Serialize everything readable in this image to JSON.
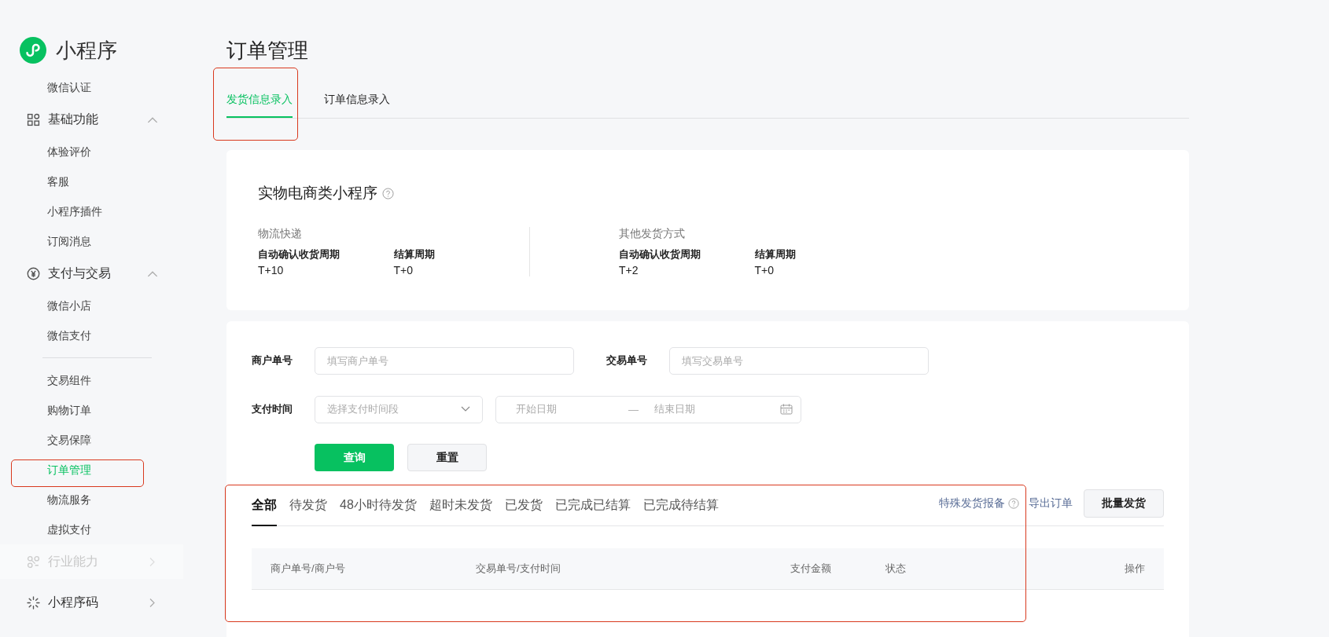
{
  "sidebar": {
    "logo": "小程序",
    "items": [
      {
        "kind": "link",
        "label": "微信认证",
        "selected": false
      },
      {
        "kind": "group",
        "label": "基础功能",
        "expanded": true,
        "disabled": false,
        "children": [
          {
            "kind": "link",
            "label": "体验评价",
            "selected": false
          },
          {
            "kind": "link",
            "label": "客服",
            "selected": false
          },
          {
            "kind": "link",
            "label": "小程序插件",
            "selected": false
          },
          {
            "kind": "link",
            "label": "订阅消息",
            "selected": false
          }
        ]
      },
      {
        "kind": "group",
        "label": "支付与交易",
        "expanded": true,
        "disabled": false,
        "children": [
          {
            "kind": "link",
            "label": "微信小店",
            "selected": false
          },
          {
            "kind": "link",
            "label": "微信支付",
            "selected": false
          },
          {
            "kind": "divider"
          },
          {
            "kind": "link",
            "label": "交易组件",
            "selected": false
          },
          {
            "kind": "link",
            "label": "购物订单",
            "selected": false
          },
          {
            "kind": "link",
            "label": "交易保障",
            "selected": false
          },
          {
            "kind": "link",
            "label": "订单管理",
            "selected": true
          },
          {
            "kind": "link",
            "label": "物流服务",
            "selected": false
          },
          {
            "kind": "link",
            "label": "虚拟支付",
            "selected": false
          }
        ]
      },
      {
        "kind": "group",
        "label": "行业能力",
        "expanded": false,
        "disabled": true
      },
      {
        "kind": "group",
        "label": "小程序码",
        "expanded": false,
        "disabled": false
      }
    ]
  },
  "page_title": "订单管理",
  "tabs": [
    {
      "label": "发货信息录入",
      "selected": true
    },
    {
      "label": "订单信息录入",
      "selected": false
    }
  ],
  "info_card": {
    "title": "实物电商类小程序",
    "groups": [
      {
        "name": "物流快递",
        "fields": [
          {
            "label": "自动确认收货周期",
            "value": "T+10"
          },
          {
            "label": "结算周期",
            "value": "T+0"
          }
        ]
      },
      {
        "name": "其他发货方式",
        "fields": [
          {
            "label": "自动确认收货周期",
            "value": "T+2"
          },
          {
            "label": "结算周期",
            "value": "T+0"
          }
        ]
      }
    ]
  },
  "filters": {
    "merchant_no": {
      "label": "商户单号",
      "placeholder": "填写商户单号"
    },
    "trade_no": {
      "label": "交易单号",
      "placeholder": "填写交易单号"
    },
    "pay_time": {
      "label": "支付时间",
      "placeholder": "选择支付时间段",
      "start_placeholder": "开始日期",
      "separator": "—",
      "end_placeholder": "结束日期"
    },
    "buttons": [
      {
        "label": "查询",
        "kind": "primary"
      },
      {
        "label": "重置",
        "kind": "default"
      }
    ]
  },
  "status_tabs": [
    {
      "label": "全部",
      "selected": true
    },
    {
      "label": "待发货",
      "selected": false
    },
    {
      "label": "48小时待发货",
      "selected": false
    },
    {
      "label": "超时未发货",
      "selected": false
    },
    {
      "label": "已发货",
      "selected": false
    },
    {
      "label": "已完成已结算",
      "selected": false
    },
    {
      "label": "已完成待结算",
      "selected": false
    }
  ],
  "actions": {
    "special_report": "特殊发货报备",
    "export": "导出订单",
    "batch_ship": "批量发货"
  },
  "table": {
    "columns": [
      "商户单号/商户号",
      "交易单号/支付时间",
      "支付金额",
      "状态",
      "操作"
    ]
  }
}
